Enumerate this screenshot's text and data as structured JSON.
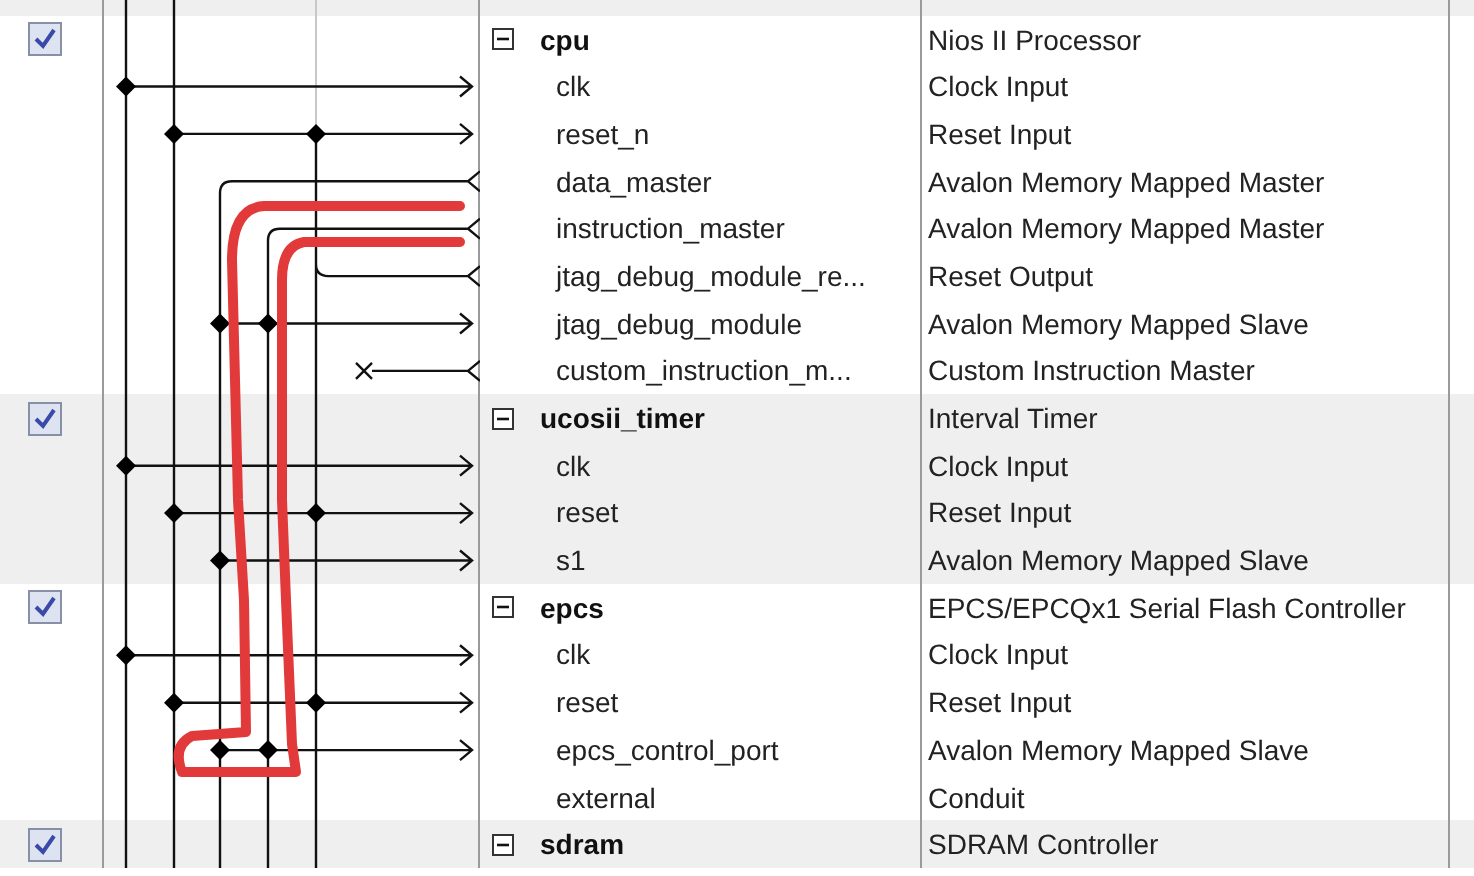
{
  "modules": [
    {
      "name": "cpu",
      "description": "Nios II Processor",
      "enabled": true,
      "expanded": true,
      "ports": [
        {
          "name": "clk",
          "description": "Clock Input"
        },
        {
          "name": "reset_n",
          "description": "Reset Input"
        },
        {
          "name": "data_master",
          "description": "Avalon Memory Mapped Master"
        },
        {
          "name": "instruction_master",
          "description": "Avalon Memory Mapped Master"
        },
        {
          "name": "jtag_debug_module_re...",
          "description": "Reset Output"
        },
        {
          "name": "jtag_debug_module",
          "description": "Avalon Memory Mapped Slave"
        },
        {
          "name": "custom_instruction_m...",
          "description": "Custom Instruction Master"
        }
      ]
    },
    {
      "name": "ucosii_timer",
      "description": "Interval Timer",
      "enabled": true,
      "expanded": true,
      "ports": [
        {
          "name": "clk",
          "description": "Clock Input"
        },
        {
          "name": "reset",
          "description": "Reset Input"
        },
        {
          "name": "s1",
          "description": "Avalon Memory Mapped Slave"
        }
      ]
    },
    {
      "name": "epcs",
      "description": "EPCS/EPCQx1 Serial Flash Controller",
      "enabled": true,
      "expanded": true,
      "ports": [
        {
          "name": "clk",
          "description": "Clock Input"
        },
        {
          "name": "reset",
          "description": "Reset Input"
        },
        {
          "name": "epcs_control_port",
          "description": "Avalon Memory Mapped Slave"
        },
        {
          "name": "external",
          "description": "Conduit"
        }
      ]
    },
    {
      "name": "sdram",
      "description": "SDRAM Controller",
      "enabled": true,
      "expanded": true
    }
  ]
}
